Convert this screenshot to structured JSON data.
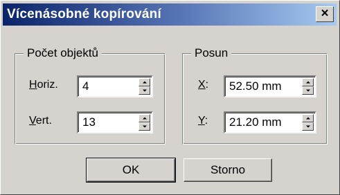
{
  "window": {
    "title": "Vícenásobné kopírování",
    "close_label": "×"
  },
  "count_group": {
    "title": "Počet objektů",
    "horiz": {
      "label_accel": "H",
      "label_rest": "oriz.",
      "value": "4"
    },
    "vert": {
      "label_accel": "V",
      "label_rest": "ert.",
      "value": "13"
    }
  },
  "offset_group": {
    "title": "Posun",
    "x": {
      "label_accel": "X",
      "label_rest": ":",
      "value": "52.50 mm"
    },
    "y": {
      "label_accel": "Y",
      "label_rest": ":",
      "value": "21.20 mm"
    }
  },
  "buttons": {
    "ok_label": "OK",
    "cancel_label": "Storno"
  },
  "icons": {
    "close": "close-icon",
    "spin_up": "arrow-up-icon",
    "spin_down": "arrow-down-icon"
  },
  "colors": {
    "titlebar_start": "#0a246a",
    "titlebar_end": "#a6caf0",
    "face": "#d6d3ce"
  }
}
